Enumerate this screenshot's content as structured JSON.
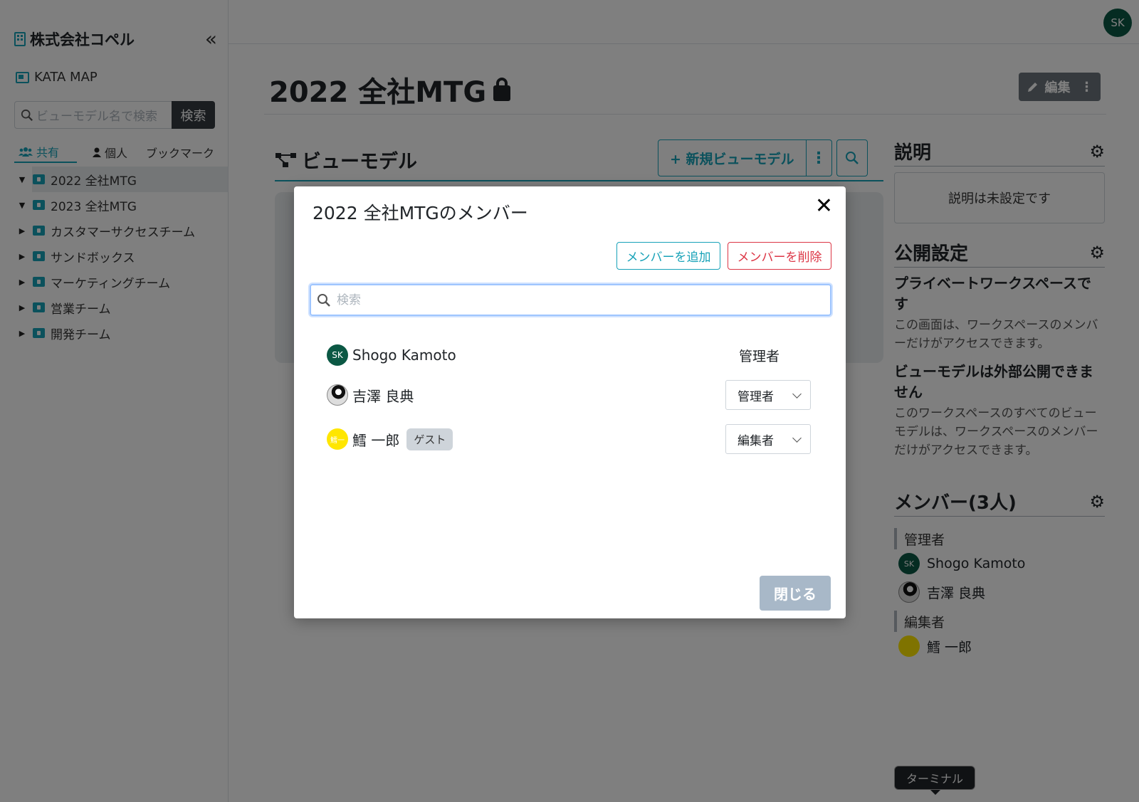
{
  "sidebar": {
    "org_name": "株式会社コペル",
    "collapse_icon": "«",
    "kata_map": "KATA MAP",
    "search_placeholder": "ビューモデル名で検索",
    "search_button": "検索",
    "tabs": [
      {
        "label": "共有",
        "icon": "users-icon",
        "active": true
      },
      {
        "label": "個人",
        "icon": "user-icon"
      },
      {
        "label": "ブックマーク"
      }
    ],
    "tree": [
      {
        "label": "2022 全社MTG",
        "expanded": true,
        "selected": true
      },
      {
        "label": "2023 全社MTG",
        "expanded": true
      },
      {
        "label": "カスタマーサクセスチーム"
      },
      {
        "label": "サンドボックス"
      },
      {
        "label": "マーケティングチーム"
      },
      {
        "label": "営業チーム"
      },
      {
        "label": "開発チーム"
      }
    ]
  },
  "header": {
    "avatar_initials": "SK",
    "page_title": "2022 全社MTG",
    "edit_button": "編集"
  },
  "viewmodel": {
    "heading": "ビューモデル",
    "new_button": "+ 新規ビューモデル"
  },
  "right_panel": {
    "description": {
      "heading": "説明",
      "empty_text": "説明は未設定です"
    },
    "visibility": {
      "heading": "公開設定",
      "private_title": "プライベートワークスペースです",
      "private_text": "この画面は、ワークスペースのメンバーだけがアクセスできます。",
      "external_title": "ビューモデルは外部公開できません",
      "external_text": "このワークスペースのすべてのビューモデルは、ワークスペースのメンバーだけがアクセスできます。"
    },
    "members": {
      "heading": "メンバー(3人)",
      "admin_label": "管理者",
      "editor_label": "編集者",
      "admins": [
        "Shogo Kamoto",
        "吉澤 良典"
      ],
      "editors": [
        "鱈 一郎"
      ],
      "sk_initials": "SK"
    }
  },
  "tooltip": "ターミナル",
  "modal": {
    "title": "2022 全社MTGのメンバー",
    "close_icon": "✕",
    "add_button": "メンバーを追加",
    "remove_button": "メンバーを削除",
    "search_placeholder": "検索",
    "members": [
      {
        "name": "Shogo Kamoto",
        "role": "管理者",
        "avatar": "SK"
      },
      {
        "name": "吉澤 良典",
        "role": "管理者"
      },
      {
        "name": "鱈 一郎",
        "role": "編集者",
        "badge": "ゲスト",
        "avatar": "鱈一"
      }
    ],
    "close_button": "閉じる"
  },
  "colors": {
    "accent": "#17a2b8",
    "danger": "#dc3545",
    "avatar_green": "#0b5844",
    "avatar_yellow": "#ffe600"
  }
}
